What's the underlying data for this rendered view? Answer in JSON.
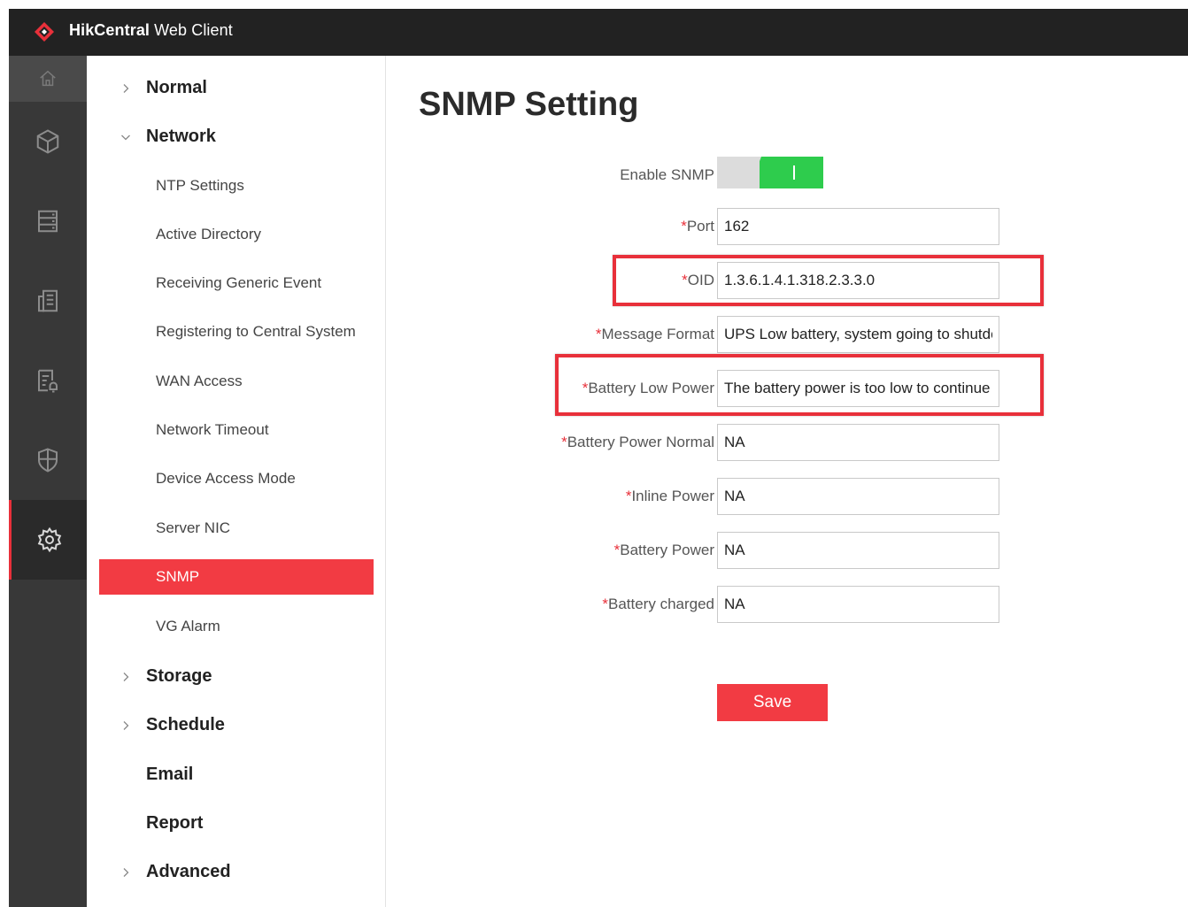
{
  "app": {
    "title_bold": "HikCentral",
    "title_rest": " Web Client",
    "brand_color": "#e8303a"
  },
  "iconbar": {
    "items": [
      {
        "icon": "home-icon"
      },
      {
        "icon": "cube-icon"
      },
      {
        "icon": "server-icon"
      },
      {
        "icon": "building-icon"
      },
      {
        "icon": "event-bell-icon"
      },
      {
        "icon": "shield-icon"
      },
      {
        "icon": "gear-icon",
        "active": true
      }
    ]
  },
  "nav": {
    "normal": "Normal",
    "network": "Network",
    "network_items": [
      "NTP Settings",
      "Active Directory",
      "Receiving Generic Event",
      "Registering to Central System",
      "WAN Access",
      "Network Timeout",
      "Device Access Mode",
      "Server NIC",
      "SNMP",
      "VG Alarm"
    ],
    "storage": "Storage",
    "schedule": "Schedule",
    "email": "Email",
    "report": "Report",
    "advanced": "Advanced"
  },
  "main": {
    "title": "SNMP Setting",
    "enable_label": "Enable SNMP",
    "enable_value": true,
    "required_mark": "*",
    "fields": [
      {
        "label": "Port",
        "value": "162"
      },
      {
        "label": "OID",
        "value": "1.3.6.1.4.1.318.2.3.3.0"
      },
      {
        "label": "Message Format",
        "value": "UPS Low battery, system going to shutdown"
      },
      {
        "label": "Battery Low Power",
        "value": "The battery power is too low to continue"
      },
      {
        "label": "Battery Power Normal",
        "value": "NA"
      },
      {
        "label": "Inline Power",
        "value": "NA"
      },
      {
        "label": "Battery Power",
        "value": "NA"
      },
      {
        "label": "Battery charged",
        "value": "NA"
      }
    ],
    "save_label": "Save"
  }
}
